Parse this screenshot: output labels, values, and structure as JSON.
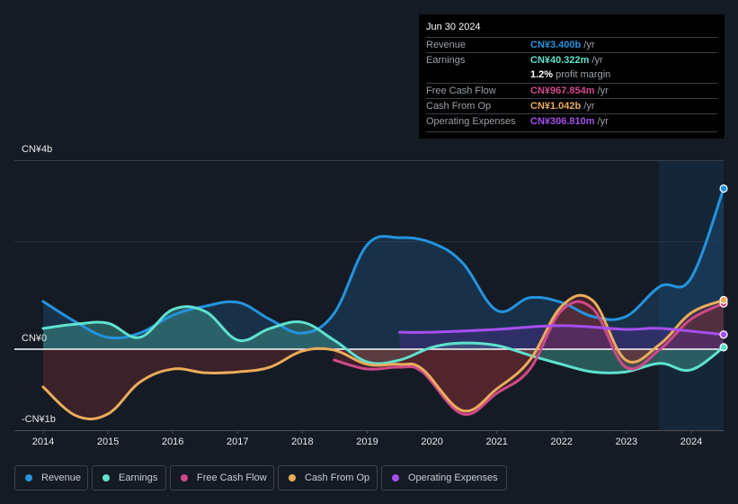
{
  "tooltip": {
    "date": "Jun 30 2024",
    "rows": [
      {
        "label": "Revenue",
        "value": "CN¥3.400b",
        "unit": " /yr",
        "color": "#2394df"
      },
      {
        "label": "Earnings",
        "value": "CN¥40.322m",
        "unit": " /yr",
        "color": "#5ee2cf"
      },
      {
        "label": "",
        "value": "1.2%",
        "unit": " profit margin",
        "color": "#ffffff"
      },
      {
        "label": "Free Cash Flow",
        "value": "CN¥967.854m",
        "unit": " /yr",
        "color": "#d0498b"
      },
      {
        "label": "Cash From Op",
        "value": "CN¥1.042b",
        "unit": " /yr",
        "color": "#eaac5a"
      },
      {
        "label": "Operating Expenses",
        "value": "CN¥306.810m",
        "unit": " /yr",
        "color": "#a64ff0"
      }
    ]
  },
  "chart_data": {
    "type": "line",
    "title": "",
    "xlabel": "",
    "ylabel": "",
    "y_tick_labels": [
      "CN¥4b",
      "CN¥0",
      "-CN¥1b"
    ],
    "x_tick_labels": [
      "2014",
      "2015",
      "2016",
      "2017",
      "2018",
      "2019",
      "2020",
      "2021",
      "2022",
      "2023",
      "2024"
    ],
    "xlim": [
      2014.0,
      2024.5
    ],
    "ylim": [
      -1.5,
      4.0
    ],
    "units": "CN¥ billions",
    "grid": true,
    "legend_position": "bottom-left",
    "highlight_range": [
      2023.5,
      2024.5
    ],
    "series": [
      {
        "name": "Revenue",
        "color": "#2394df",
        "x": [
          2014.0,
          2014.51,
          2015.0,
          2015.49,
          2016.0,
          2016.5,
          2017.01,
          2017.5,
          2018.0,
          2018.49,
          2019.0,
          2019.5,
          2020.0,
          2020.47,
          2021.0,
          2021.51,
          2022.0,
          2022.48,
          2022.99,
          2023.52,
          2023.99,
          2024.5
        ],
        "values": [
          1.01,
          0.57,
          0.25,
          0.34,
          0.72,
          0.91,
          0.99,
          0.63,
          0.34,
          0.76,
          2.21,
          2.36,
          2.25,
          1.83,
          0.82,
          1.09,
          0.99,
          0.69,
          0.69,
          1.33,
          1.49,
          3.4
        ]
      },
      {
        "name": "Earnings",
        "color": "#5ee2cf",
        "x": [
          2014.0,
          2014.51,
          2015.0,
          2015.49,
          2016.0,
          2016.5,
          2017.01,
          2017.5,
          2018.0,
          2018.49,
          2019.0,
          2019.5,
          2020.0,
          2020.47,
          2021.0,
          2021.51,
          2022.0,
          2022.48,
          2022.99,
          2023.52,
          2023.99,
          2024.5
        ],
        "values": [
          0.44,
          0.53,
          0.55,
          0.25,
          0.84,
          0.8,
          0.19,
          0.44,
          0.57,
          0.19,
          -0.27,
          -0.23,
          0.04,
          0.13,
          0.08,
          -0.13,
          -0.32,
          -0.48,
          -0.48,
          -0.3,
          -0.44,
          0.04
        ]
      },
      {
        "name": "Free Cash Flow",
        "color": "#d0498b",
        "x": [
          2018.49,
          2019.0,
          2019.5,
          2019.85,
          2020.47,
          2021.0,
          2021.51,
          2022.0,
          2022.48,
          2022.99,
          2023.52,
          2023.99,
          2024.5
        ],
        "values": [
          -0.23,
          -0.42,
          -0.38,
          -0.48,
          -1.37,
          -0.93,
          -0.42,
          0.82,
          0.86,
          -0.38,
          0.0,
          0.63,
          0.97
        ]
      },
      {
        "name": "Cash From Op",
        "color": "#eaac5a",
        "x": [
          2014.0,
          2014.51,
          2015.0,
          2015.49,
          2016.0,
          2016.5,
          2017.01,
          2017.5,
          2018.0,
          2018.49,
          2019.0,
          2019.5,
          2019.85,
          2020.47,
          2021.0,
          2021.51,
          2022.0,
          2022.48,
          2022.99,
          2023.52,
          2023.99,
          2024.5
        ],
        "values": [
          -0.8,
          -1.41,
          -1.37,
          -0.7,
          -0.42,
          -0.5,
          -0.48,
          -0.38,
          -0.04,
          -0.02,
          -0.32,
          -0.32,
          -0.42,
          -1.3,
          -0.84,
          -0.23,
          0.91,
          1.03,
          -0.23,
          0.11,
          0.76,
          1.04
        ]
      },
      {
        "name": "Operating Expenses",
        "color": "#a64ff0",
        "x": [
          2019.5,
          2020.0,
          2021.0,
          2022.0,
          2022.99,
          2023.52,
          2024.5
        ],
        "values": [
          0.36,
          0.36,
          0.42,
          0.5,
          0.42,
          0.44,
          0.31
        ]
      }
    ]
  },
  "legend": [
    {
      "label": "Revenue",
      "color": "#2394df"
    },
    {
      "label": "Earnings",
      "color": "#5ee2cf"
    },
    {
      "label": "Free Cash Flow",
      "color": "#d0498b"
    },
    {
      "label": "Cash From Op",
      "color": "#eaac5a"
    },
    {
      "label": "Operating Expenses",
      "color": "#a64ff0"
    }
  ]
}
